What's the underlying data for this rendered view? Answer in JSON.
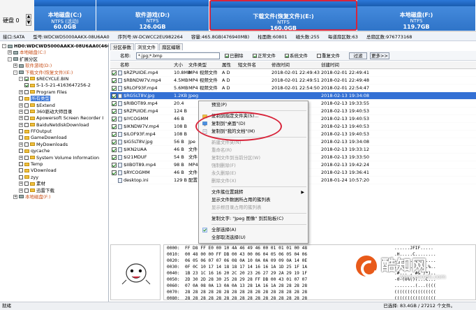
{
  "diskmap": {
    "disk_label": "硬盘 0",
    "partitions": [
      {
        "name": "本地磁盘(C:)",
        "fs": "NTFS (活动)",
        "size": "60.0GB"
      },
      {
        "name": "软件游戏(D:)",
        "fs": "NTFS",
        "size": "126.0GB"
      },
      {
        "name": "下载文件(恢复文件)(E:)",
        "fs": "NTFS",
        "size": "160.0GB"
      },
      {
        "name": "本地磁盘(F:)",
        "fs": "NTFS",
        "size": "119.7GB"
      }
    ]
  },
  "info": {
    "iface": "接口:SATA",
    "model": "型号:WDCWD5000AAKX-08U6AA0",
    "serial": "序列号:W-DCWCC2EU982264",
    "capacity": "容量:465.8GB(476940MB)",
    "cylinders": "柱面数:60801",
    "heads": "磁头数:255",
    "sectors": "每道扇区数:63",
    "total": "总扇区数:976773168"
  },
  "tree": {
    "rows": [
      {
        "label": "HD0:WDCWD5000AAKX-08U6AA0(466GB)",
        "indent": 0,
        "kind": "drv",
        "exp": "-",
        "bold": true
      },
      {
        "label": "本地磁盘(C:)",
        "indent": 1,
        "kind": "drv",
        "exp": "+",
        "cls": "orange"
      },
      {
        "label": "扩展分区",
        "indent": 1,
        "kind": "drv",
        "exp": "-"
      },
      {
        "label": "软件游戏(D:)",
        "indent": 2,
        "kind": "drv",
        "exp": "+",
        "cls": "orange"
      },
      {
        "label": "下载文件(恢复文件)(E:)",
        "indent": 2,
        "kind": "drv",
        "exp": "-",
        "cls": "orange"
      },
      {
        "label": "$RECYCLE.BIN",
        "indent": 3,
        "kind": "fold",
        "exp": "-",
        "chk": true
      },
      {
        "label": "S-1-5-21-4163647256-2",
        "indent": 4,
        "kind": "fold",
        "exp": "",
        "chk": true
      },
      {
        "label": "Program Files",
        "indent": 3,
        "kind": "fold",
        "exp": "+",
        "chk": false
      },
      {
        "label": "所有类型",
        "indent": 3,
        "kind": "fold",
        "exp": "",
        "chk": false,
        "cls": "pink"
      },
      {
        "label": "$Extend",
        "indent": 3,
        "kind": "fold",
        "exp": "+",
        "chk": false
      },
      {
        "label": "360驱动大师目录",
        "indent": 3,
        "kind": "fold",
        "exp": "+",
        "chk": false
      },
      {
        "label": "Apowersoft Screen Recorder I",
        "indent": 3,
        "kind": "fold",
        "exp": "+",
        "chk": false
      },
      {
        "label": "BaiduNetdiskDownload",
        "indent": 3,
        "kind": "fold",
        "exp": "+",
        "chk": false
      },
      {
        "label": "FFOutput",
        "indent": 3,
        "kind": "fold",
        "exp": "",
        "chk": false
      },
      {
        "label": "GameDownload",
        "indent": 3,
        "kind": "fold",
        "exp": "",
        "chk": false
      },
      {
        "label": "MyDownloads",
        "indent": 3,
        "kind": "fold",
        "exp": "+",
        "chk": false
      },
      {
        "label": "qycache",
        "indent": 3,
        "kind": "fold",
        "exp": "",
        "chk": false
      },
      {
        "label": "System Volume Information",
        "indent": 3,
        "kind": "fold",
        "exp": "+",
        "chk": false
      },
      {
        "label": "Temp",
        "indent": 3,
        "kind": "fold",
        "exp": "",
        "chk": false
      },
      {
        "label": "VDownload",
        "indent": 3,
        "kind": "fold",
        "exp": "",
        "chk": false
      },
      {
        "label": "zyy",
        "indent": 3,
        "kind": "fold",
        "exp": "",
        "chk": false
      },
      {
        "label": "素材",
        "indent": 3,
        "kind": "fold",
        "exp": "+",
        "chk": false
      },
      {
        "label": "迅雷下载",
        "indent": 3,
        "kind": "fold",
        "exp": "+",
        "chk": false
      },
      {
        "label": "本地磁盘(F:)",
        "indent": 2,
        "kind": "drv",
        "exp": "+",
        "cls": "orange"
      }
    ]
  },
  "tabs": [
    "分区参数",
    "浏览文件",
    "扇区编辑"
  ],
  "filter": {
    "label": "名称:",
    "value": "*.jpg;*.bmp",
    "opts": [
      {
        "label": "已删除",
        "on": true
      },
      {
        "label": "正常文件",
        "on": true
      },
      {
        "label": "系统文件",
        "on": true
      },
      {
        "label": "重复文件",
        "on": false
      }
    ],
    "filter_btn": "过滤",
    "more_btn": "更多>>"
  },
  "list": {
    "headers": [
      "名称",
      "大小",
      "文件类型",
      "属性",
      "短文件名",
      "修改时间",
      "创建时间"
    ],
    "rows": [
      {
        "name": "$RZPUIDE.mp4",
        "size": "10.8MB",
        "type": "MP4 视频文件",
        "attr": "A D",
        "short": "",
        "mod": "2018-02-01 22:49:43",
        "created": "2018-02-01 22:49:41"
      },
      {
        "name": "$RBNDW7V.mp4",
        "size": "4.5MB",
        "type": "MP4 视频文件",
        "attr": "A D",
        "short": "",
        "mod": "2018-02-01 22:49:51",
        "created": "2018-02-01 22:49:48"
      },
      {
        "name": "$RLOF93F.mp4",
        "size": "5.6MB",
        "type": "MP4 视频文件",
        "attr": "A D",
        "short": "",
        "mod": "2018-02-01 22:54:50",
        "created": "2018-02-01 22:54:47"
      },
      {
        "name": "$RG5LT8V.jpg",
        "size": "1.2KB",
        "type": "Jpeg",
        "attr": "",
        "short": "",
        "mod": "",
        "created": "2018-02-13 19:34:08",
        "sel": true
      },
      {
        "name": "$RIBOT89.mp4",
        "size": "20.4",
        "type": "",
        "attr": "",
        "short": "",
        "mod": "",
        "created": "2018-02-13 19:33:55"
      },
      {
        "name": "$RZPUIDE.mp4",
        "size": "124 B",
        "type": "",
        "attr": "",
        "short": "",
        "mod": "",
        "created": "2018-02-13 19:40:53"
      },
      {
        "name": "$IYCOGMM",
        "size": "46 B",
        "type": "",
        "attr": "",
        "short": "",
        "mod": "",
        "created": "2018-02-13 19:40:53"
      },
      {
        "name": "$IKNDW7V.mp4",
        "size": "108 B",
        "type": "",
        "attr": "",
        "short": "",
        "mod": "",
        "created": "2018-02-13 19:40:53"
      },
      {
        "name": "$ILOF93F.mp4",
        "size": "108 B",
        "type": "",
        "attr": "",
        "short": "",
        "mod": "",
        "created": "2018-02-13 19:40:53"
      },
      {
        "name": "$IG5LT8V.jpg",
        "size": "56 B",
        "type": "Jpe",
        "attr": "",
        "short": "",
        "mod": "",
        "created": "2018-02-13 19:34:08"
      },
      {
        "name": "$IKN2UAA",
        "size": "46 B",
        "type": "文件",
        "attr": "",
        "short": "",
        "mod": "",
        "created": "2018-02-13 19:33:12"
      },
      {
        "name": "$I21MDUF",
        "size": "54 B",
        "type": "文件",
        "attr": "",
        "short": "",
        "mod": "",
        "created": "2018-02-13 19:33:50"
      },
      {
        "name": "$IIBOT89.mp4",
        "size": "98 B",
        "type": "MP4",
        "attr": "",
        "short": "",
        "mod": "",
        "created": "2018-02-13 19:42:24"
      },
      {
        "name": "$RYCOGMM",
        "size": "46 B",
        "type": "文件",
        "attr": "",
        "short": "",
        "mod": "",
        "created": "2018-02-13 19:36:41"
      },
      {
        "name": "desktop.ini",
        "size": "129 B",
        "type": "配置",
        "attr": "",
        "short": "",
        "mod": "",
        "created": "2018-01-24 10:57:20",
        "nochk": true
      }
    ]
  },
  "menu": {
    "items": [
      {
        "label": "预览(P)",
        "dis": false,
        "icon": ""
      },
      {
        "sep": true
      },
      {
        "label": "复制到指定文件夹(S)...",
        "dis": false,
        "icon": "folder"
      },
      {
        "label": "复制到\"桌面\"(D)",
        "dis": false,
        "icon": "desk"
      },
      {
        "label": "复制到\"我的文档\"(M)",
        "dis": false,
        "icon": "doc"
      },
      {
        "sep": true
      },
      {
        "label": "新建文件夹(N)",
        "dis": true,
        "icon": ""
      },
      {
        "label": "重命名(R)",
        "dis": true,
        "icon": ""
      },
      {
        "label": "复制文件到当前分区(W)",
        "dis": true,
        "icon": ""
      },
      {
        "label": "强制删除(F)",
        "dis": true,
        "icon": ""
      },
      {
        "label": "永久删除(E)",
        "dis": true,
        "icon": ""
      },
      {
        "label": "删除文件(X)",
        "dis": true,
        "icon": ""
      },
      {
        "sep": true
      },
      {
        "label": "文件簇位置跳转",
        "dis": false,
        "icon": "",
        "arrow": true
      },
      {
        "label": "显示文件数据所占用的簇列表",
        "dis": false,
        "icon": ""
      },
      {
        "label": "显示根目录占用的簇列表",
        "dis": true,
        "icon": ""
      },
      {
        "sep": true
      },
      {
        "label": "复制文字: \"Jpeg 图像\" 到剪贴板(C)",
        "dis": false,
        "icon": ""
      },
      {
        "sep": true
      },
      {
        "label": "全部选择(A)",
        "dis": false,
        "icon": "check"
      },
      {
        "label": "全部取消选择(U)",
        "dis": false,
        "icon": ""
      }
    ]
  },
  "hex": {
    "rows": [
      {
        "off": "0000:",
        "bytes": "FF D8 FF E0 00 10 4A 46 49 46 00 01 01 01 00 48",
        "ascii": "......JFIF....."
      },
      {
        "off": "0010:",
        "bytes": "00 48 00 00 FF DB 00 43 00 06 04 05 06 05 04 06",
        "ascii": ".H.....C........"
      },
      {
        "off": "0020:",
        "bytes": "06 05 06 07 07 06 08 0A 10 0A 0A 09 09 0A 14 0E",
        "ascii": "................"
      },
      {
        "off": "0030:",
        "bytes": "0F 0C 10 17 14 18 18 17 14 16 16 1A 1D 25 1F 1A",
        "ascii": ".............%.."
      },
      {
        "off": "0040:",
        "bytes": "1B 23 1C 16 16 20 2C 20 23 26 27 29 2A 29 19 1F",
        "ascii": ".#... , #&')*).."
      },
      {
        "off": "0050:",
        "bytes": "2D 30 2D 28 30 25 28 29 28 FF DB 00 43 01 07 07",
        "ascii": "-0-(0%()(...C..."
      },
      {
        "off": "0060:",
        "bytes": "07 0A 08 0A 13 0A 0A 13 28 1A 16 1A 28 28 28 28",
        "ascii": "........(...(((("
      },
      {
        "off": "0070:",
        "bytes": "28 28 28 28 28 28 28 28 28 28 28 28 28 28 28 28",
        "ascii": "(((((((((((((((("
      },
      {
        "off": "0080:",
        "bytes": "28 28 28 28 28 28 28 28 28 28 28 28 28 28 28 28",
        "ascii": "(((((((((((((((("
      }
    ]
  },
  "watermark": {
    "name": "酷知网",
    "url": "www.coozhi.com"
  },
  "status": {
    "left": "就绪",
    "right": "已选择: 83.4GB / 27212 个文件。"
  }
}
